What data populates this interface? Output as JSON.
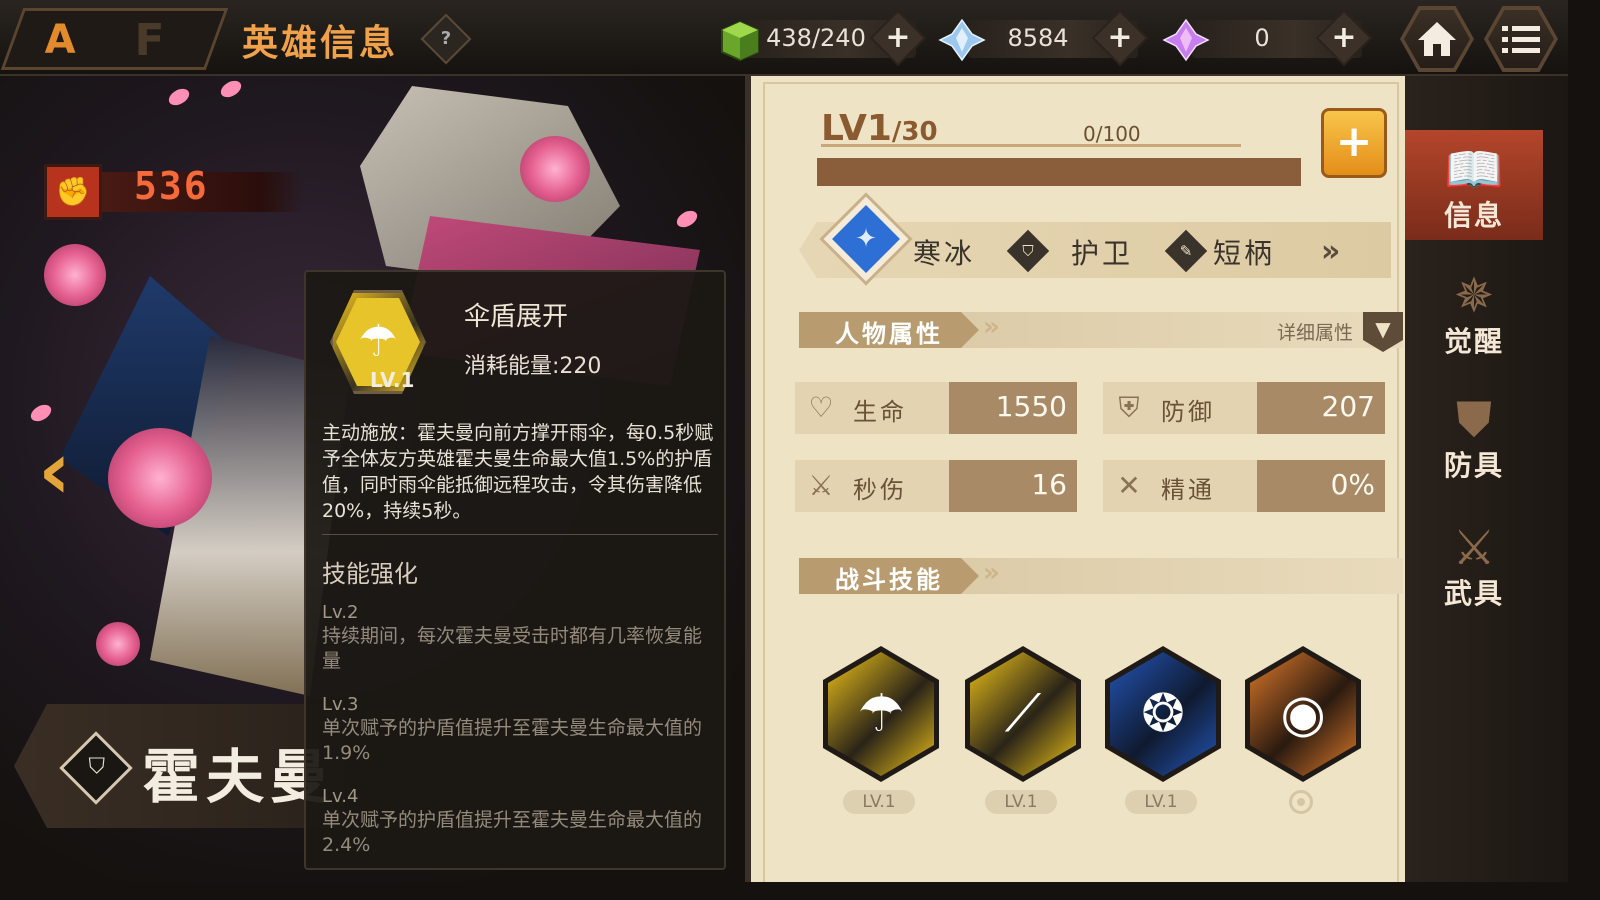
{
  "header": {
    "page_title": "英雄信息",
    "help_icon": "question-icon",
    "currencies": [
      {
        "icon": "stamina-cube-icon",
        "value": "438/240"
      },
      {
        "icon": "blue-crystal-icon",
        "value": "8584"
      },
      {
        "icon": "purple-crystal-icon",
        "value": "0"
      }
    ],
    "plus_symbol": "+"
  },
  "hero": {
    "power": "536",
    "name": "霍夫曼",
    "prev_arrow": "‹"
  },
  "tooltip": {
    "skill_name": "伞盾展开",
    "level": "LV.1",
    "cost": "消耗能量:220",
    "description": "主动施放：霍夫曼向前方撑开雨伞，每0.5秒赋予全体友方英雄霍夫曼生命最大值1.5%的护盾值，同时雨伞能抵御远程攻击，令其伤害降低20%，持续5秒。",
    "enhance_title": "技能强化",
    "enhancements": [
      {
        "lv": "Lv.2",
        "text": "持续期间，每次霍夫曼受击时都有几率恢复能量"
      },
      {
        "lv": "Lv.3",
        "text": "单次赋予的护盾值提升至霍夫曼生命最大值的1.9%"
      },
      {
        "lv": "Lv.4",
        "text": "单次赋予的护盾值提升至霍夫曼生命最大值的2.4%"
      }
    ]
  },
  "level": {
    "label": "LV1",
    "max": "/30",
    "progress_text": "0/100",
    "progress_fraction": 0,
    "plus": "+"
  },
  "tags": {
    "element": "寒冰",
    "role": "护卫",
    "weapon": "短柄"
  },
  "attributes_section": {
    "title": "人物属性",
    "detail_link": "详细属性",
    "items": [
      {
        "label": "生命",
        "value": "1550",
        "icon": "heart-icon"
      },
      {
        "label": "防御",
        "value": "207",
        "icon": "shield-icon"
      },
      {
        "label": "秒伤",
        "value": "16",
        "icon": "swords-icon"
      },
      {
        "label": "精通",
        "value": "0%",
        "icon": "crossed-blades-icon"
      }
    ]
  },
  "skills_section": {
    "title": "战斗技能",
    "skills": [
      {
        "icon": "umbrella-shield-icon",
        "level": "LV.1",
        "color": "#f0c419"
      },
      {
        "icon": "lance-strike-icon",
        "level": "LV.1",
        "color": "#f0c419"
      },
      {
        "icon": "blue-swirl-icon",
        "level": "LV.1",
        "color": "#2456b8"
      },
      {
        "icon": "orange-drill-icon",
        "level": "",
        "color": "#e07a2a"
      }
    ]
  },
  "sidebar": {
    "tabs": [
      {
        "label": "信息",
        "icon": "book-icon",
        "active": true
      },
      {
        "label": "觉醒",
        "icon": "awaken-emblem-icon",
        "active": false
      },
      {
        "label": "防具",
        "icon": "armor-icon",
        "active": false
      },
      {
        "label": "武具",
        "icon": "bow-sword-icon",
        "active": false
      }
    ]
  }
}
